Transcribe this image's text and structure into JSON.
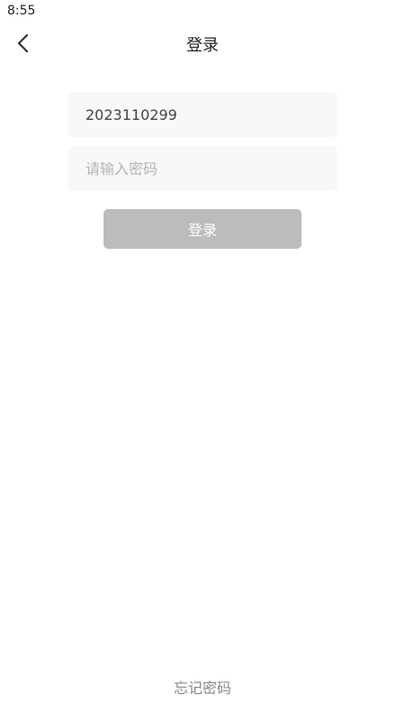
{
  "status_bar": {
    "time": "8:55"
  },
  "nav": {
    "title": "登录",
    "back_icon": "chevron-left-icon"
  },
  "form": {
    "username_value": "2023110299",
    "password_placeholder": "请输入密码",
    "password_value": "",
    "login_label": "登录"
  },
  "footer": {
    "forgot_label": "忘记密码"
  },
  "colors": {
    "button_disabled": "#bcbcbc",
    "field_background": "#f8f8f8",
    "placeholder": "#b3b3b3"
  }
}
